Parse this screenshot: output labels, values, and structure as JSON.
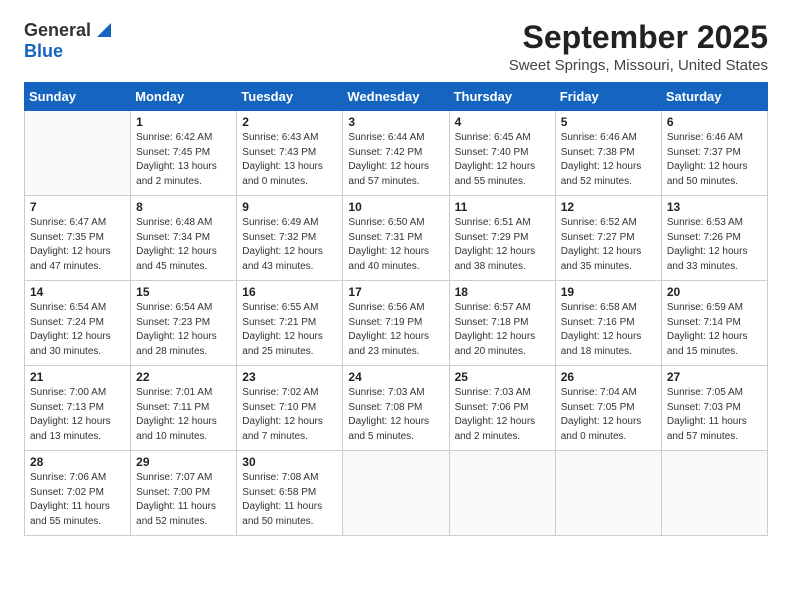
{
  "header": {
    "logo_general": "General",
    "logo_blue": "Blue",
    "month_title": "September 2025",
    "subtitle": "Sweet Springs, Missouri, United States"
  },
  "weekdays": [
    "Sunday",
    "Monday",
    "Tuesday",
    "Wednesday",
    "Thursday",
    "Friday",
    "Saturday"
  ],
  "weeks": [
    [
      {
        "day": "",
        "sunrise": "",
        "sunset": "",
        "daylight": "",
        "empty": true
      },
      {
        "day": "1",
        "sunrise": "Sunrise: 6:42 AM",
        "sunset": "Sunset: 7:45 PM",
        "daylight": "Daylight: 13 hours and 2 minutes."
      },
      {
        "day": "2",
        "sunrise": "Sunrise: 6:43 AM",
        "sunset": "Sunset: 7:43 PM",
        "daylight": "Daylight: 13 hours and 0 minutes."
      },
      {
        "day": "3",
        "sunrise": "Sunrise: 6:44 AM",
        "sunset": "Sunset: 7:42 PM",
        "daylight": "Daylight: 12 hours and 57 minutes."
      },
      {
        "day": "4",
        "sunrise": "Sunrise: 6:45 AM",
        "sunset": "Sunset: 7:40 PM",
        "daylight": "Daylight: 12 hours and 55 minutes."
      },
      {
        "day": "5",
        "sunrise": "Sunrise: 6:46 AM",
        "sunset": "Sunset: 7:38 PM",
        "daylight": "Daylight: 12 hours and 52 minutes."
      },
      {
        "day": "6",
        "sunrise": "Sunrise: 6:46 AM",
        "sunset": "Sunset: 7:37 PM",
        "daylight": "Daylight: 12 hours and 50 minutes."
      }
    ],
    [
      {
        "day": "7",
        "sunrise": "Sunrise: 6:47 AM",
        "sunset": "Sunset: 7:35 PM",
        "daylight": "Daylight: 12 hours and 47 minutes."
      },
      {
        "day": "8",
        "sunrise": "Sunrise: 6:48 AM",
        "sunset": "Sunset: 7:34 PM",
        "daylight": "Daylight: 12 hours and 45 minutes."
      },
      {
        "day": "9",
        "sunrise": "Sunrise: 6:49 AM",
        "sunset": "Sunset: 7:32 PM",
        "daylight": "Daylight: 12 hours and 43 minutes."
      },
      {
        "day": "10",
        "sunrise": "Sunrise: 6:50 AM",
        "sunset": "Sunset: 7:31 PM",
        "daylight": "Daylight: 12 hours and 40 minutes."
      },
      {
        "day": "11",
        "sunrise": "Sunrise: 6:51 AM",
        "sunset": "Sunset: 7:29 PM",
        "daylight": "Daylight: 12 hours and 38 minutes."
      },
      {
        "day": "12",
        "sunrise": "Sunrise: 6:52 AM",
        "sunset": "Sunset: 7:27 PM",
        "daylight": "Daylight: 12 hours and 35 minutes."
      },
      {
        "day": "13",
        "sunrise": "Sunrise: 6:53 AM",
        "sunset": "Sunset: 7:26 PM",
        "daylight": "Daylight: 12 hours and 33 minutes."
      }
    ],
    [
      {
        "day": "14",
        "sunrise": "Sunrise: 6:54 AM",
        "sunset": "Sunset: 7:24 PM",
        "daylight": "Daylight: 12 hours and 30 minutes."
      },
      {
        "day": "15",
        "sunrise": "Sunrise: 6:54 AM",
        "sunset": "Sunset: 7:23 PM",
        "daylight": "Daylight: 12 hours and 28 minutes."
      },
      {
        "day": "16",
        "sunrise": "Sunrise: 6:55 AM",
        "sunset": "Sunset: 7:21 PM",
        "daylight": "Daylight: 12 hours and 25 minutes."
      },
      {
        "day": "17",
        "sunrise": "Sunrise: 6:56 AM",
        "sunset": "Sunset: 7:19 PM",
        "daylight": "Daylight: 12 hours and 23 minutes."
      },
      {
        "day": "18",
        "sunrise": "Sunrise: 6:57 AM",
        "sunset": "Sunset: 7:18 PM",
        "daylight": "Daylight: 12 hours and 20 minutes."
      },
      {
        "day": "19",
        "sunrise": "Sunrise: 6:58 AM",
        "sunset": "Sunset: 7:16 PM",
        "daylight": "Daylight: 12 hours and 18 minutes."
      },
      {
        "day": "20",
        "sunrise": "Sunrise: 6:59 AM",
        "sunset": "Sunset: 7:14 PM",
        "daylight": "Daylight: 12 hours and 15 minutes."
      }
    ],
    [
      {
        "day": "21",
        "sunrise": "Sunrise: 7:00 AM",
        "sunset": "Sunset: 7:13 PM",
        "daylight": "Daylight: 12 hours and 13 minutes."
      },
      {
        "day": "22",
        "sunrise": "Sunrise: 7:01 AM",
        "sunset": "Sunset: 7:11 PM",
        "daylight": "Daylight: 12 hours and 10 minutes."
      },
      {
        "day": "23",
        "sunrise": "Sunrise: 7:02 AM",
        "sunset": "Sunset: 7:10 PM",
        "daylight": "Daylight: 12 hours and 7 minutes."
      },
      {
        "day": "24",
        "sunrise": "Sunrise: 7:03 AM",
        "sunset": "Sunset: 7:08 PM",
        "daylight": "Daylight: 12 hours and 5 minutes."
      },
      {
        "day": "25",
        "sunrise": "Sunrise: 7:03 AM",
        "sunset": "Sunset: 7:06 PM",
        "daylight": "Daylight: 12 hours and 2 minutes."
      },
      {
        "day": "26",
        "sunrise": "Sunrise: 7:04 AM",
        "sunset": "Sunset: 7:05 PM",
        "daylight": "Daylight: 12 hours and 0 minutes."
      },
      {
        "day": "27",
        "sunrise": "Sunrise: 7:05 AM",
        "sunset": "Sunset: 7:03 PM",
        "daylight": "Daylight: 11 hours and 57 minutes."
      }
    ],
    [
      {
        "day": "28",
        "sunrise": "Sunrise: 7:06 AM",
        "sunset": "Sunset: 7:02 PM",
        "daylight": "Daylight: 11 hours and 55 minutes."
      },
      {
        "day": "29",
        "sunrise": "Sunrise: 7:07 AM",
        "sunset": "Sunset: 7:00 PM",
        "daylight": "Daylight: 11 hours and 52 minutes."
      },
      {
        "day": "30",
        "sunrise": "Sunrise: 7:08 AM",
        "sunset": "Sunset: 6:58 PM",
        "daylight": "Daylight: 11 hours and 50 minutes."
      },
      {
        "day": "",
        "sunrise": "",
        "sunset": "",
        "daylight": "",
        "empty": true
      },
      {
        "day": "",
        "sunrise": "",
        "sunset": "",
        "daylight": "",
        "empty": true
      },
      {
        "day": "",
        "sunrise": "",
        "sunset": "",
        "daylight": "",
        "empty": true
      },
      {
        "day": "",
        "sunrise": "",
        "sunset": "",
        "daylight": "",
        "empty": true
      }
    ]
  ]
}
